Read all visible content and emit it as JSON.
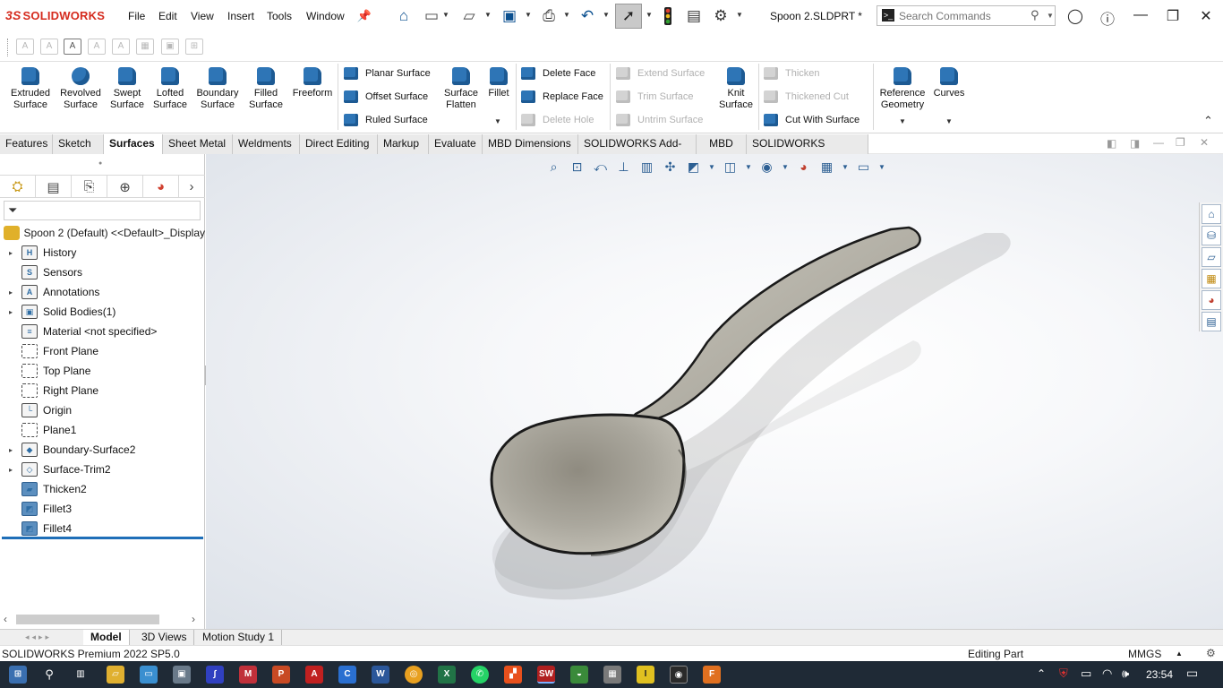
{
  "app": {
    "logo_text": "SOLIDWORKS",
    "logo_mark": "3S",
    "document_title": "Spoon 2.SLDPRT *"
  },
  "menu": [
    "File",
    "Edit",
    "View",
    "Insert",
    "Tools",
    "Window"
  ],
  "search": {
    "placeholder": "Search Commands"
  },
  "ribbon": {
    "big_buttons": [
      {
        "label": "Extruded Surface",
        "icon": "extruded-surface-icon"
      },
      {
        "label": "Revolved Surface",
        "icon": "revolved-surface-icon"
      },
      {
        "label": "Swept Surface",
        "icon": "swept-surface-icon"
      },
      {
        "label": "Lofted Surface",
        "icon": "lofted-surface-icon"
      },
      {
        "label": "Boundary Surface",
        "icon": "boundary-surface-icon"
      },
      {
        "label": "Filled Surface",
        "icon": "filled-surface-icon"
      },
      {
        "label": "Freeform",
        "icon": "freeform-icon"
      }
    ],
    "surface_col": [
      "Planar Surface",
      "Offset Surface",
      "Ruled Surface"
    ],
    "surface_flatten": "Surface Flatten",
    "fillet": "Fillet",
    "face_col": [
      "Delete Face",
      "Replace Face",
      "Delete Hole"
    ],
    "extend_col": [
      "Extend Surface",
      "Trim Surface",
      "Untrim Surface"
    ],
    "knit": "Knit Surface",
    "thicken_col": [
      "Thicken",
      "Thickened Cut",
      "Cut With Surface"
    ],
    "reference_geometry": "Reference Geometry",
    "curves": "Curves"
  },
  "tabs": [
    "Features",
    "Sketch",
    "Surfaces",
    "Sheet Metal",
    "Weldments",
    "Direct Editing",
    "Markup",
    "Evaluate",
    "MBD Dimensions",
    "SOLIDWORKS Add-Ins",
    "MBD",
    "SOLIDWORKS Visualize"
  ],
  "active_tab": "Surfaces",
  "tree": {
    "root": "Spoon 2 (Default) <<Default>_Display",
    "items": [
      {
        "label": "History",
        "expandable": true,
        "icon": "history-icon"
      },
      {
        "label": "Sensors",
        "expandable": false,
        "icon": "sensors-icon"
      },
      {
        "label": "Annotations",
        "expandable": true,
        "icon": "annotations-icon"
      },
      {
        "label": "Solid Bodies(1)",
        "expandable": true,
        "icon": "solid-bodies-icon"
      },
      {
        "label": "Material <not specified>",
        "expandable": false,
        "icon": "material-icon"
      },
      {
        "label": "Front Plane",
        "expandable": false,
        "icon": "plane-icon"
      },
      {
        "label": "Top Plane",
        "expandable": false,
        "icon": "plane-icon"
      },
      {
        "label": "Right Plane",
        "expandable": false,
        "icon": "plane-icon"
      },
      {
        "label": "Origin",
        "expandable": false,
        "icon": "origin-icon"
      },
      {
        "label": "Plane1",
        "expandable": false,
        "icon": "plane-icon"
      },
      {
        "label": "Boundary-Surface2",
        "expandable": true,
        "icon": "boundary-surface-icon"
      },
      {
        "label": "Surface-Trim2",
        "expandable": true,
        "icon": "surface-trim-icon"
      },
      {
        "label": "Thicken2",
        "expandable": false,
        "icon": "thicken-icon"
      },
      {
        "label": "Fillet3",
        "expandable": false,
        "icon": "fillet-icon"
      },
      {
        "label": "Fillet4",
        "expandable": false,
        "icon": "fillet-icon"
      }
    ]
  },
  "bottom_tabs": [
    "Model",
    "3D Views",
    "Motion Study 1"
  ],
  "status": {
    "version": "SOLIDWORKS Premium 2022 SP5.0",
    "mode": "Editing Part",
    "units": "MMGS"
  },
  "taskbar": {
    "time": "23:54"
  },
  "colors": {
    "accent": "#2e75b6",
    "logo": "#d52b1e",
    "taskbar": "#1f2a36",
    "model": "#aaa79d"
  }
}
